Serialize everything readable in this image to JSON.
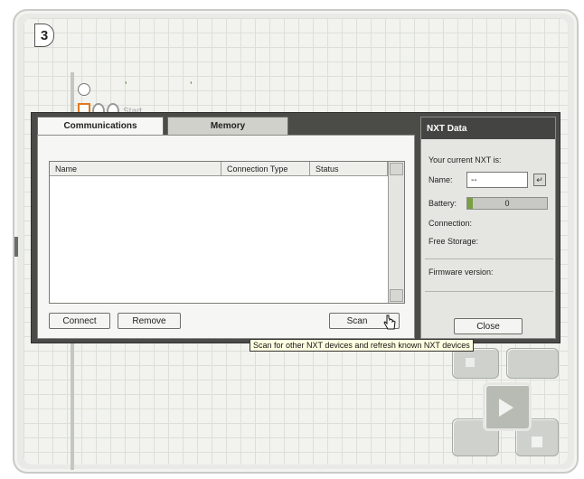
{
  "canvas": {
    "step_number": "3",
    "start_label": "Start"
  },
  "tabs": [
    {
      "label": "Communications",
      "active": true
    },
    {
      "label": "Memory",
      "active": false
    }
  ],
  "device_list": {
    "columns": [
      "Name",
      "Connection Type",
      "Status"
    ],
    "rows": []
  },
  "buttons": {
    "connect": "Connect",
    "remove": "Remove",
    "scan": "Scan",
    "close": "Close"
  },
  "nxt_data": {
    "title": "NXT Data",
    "current_nxt_label": "Your current NXT is:",
    "name_label": "Name:",
    "name_value": "--",
    "battery_label": "Battery:",
    "battery_value": "0",
    "connection_label": "Connection:",
    "free_storage_label": "Free Storage:",
    "firmware_label": "Firmware version:"
  },
  "tooltip": "Scan for other NXT devices and refresh known NXT devices",
  "colors": {
    "window_frame": "#4b4b48",
    "panel_title": "#444442",
    "battery_fill": "#7aa044",
    "start_block": "#e07820"
  }
}
